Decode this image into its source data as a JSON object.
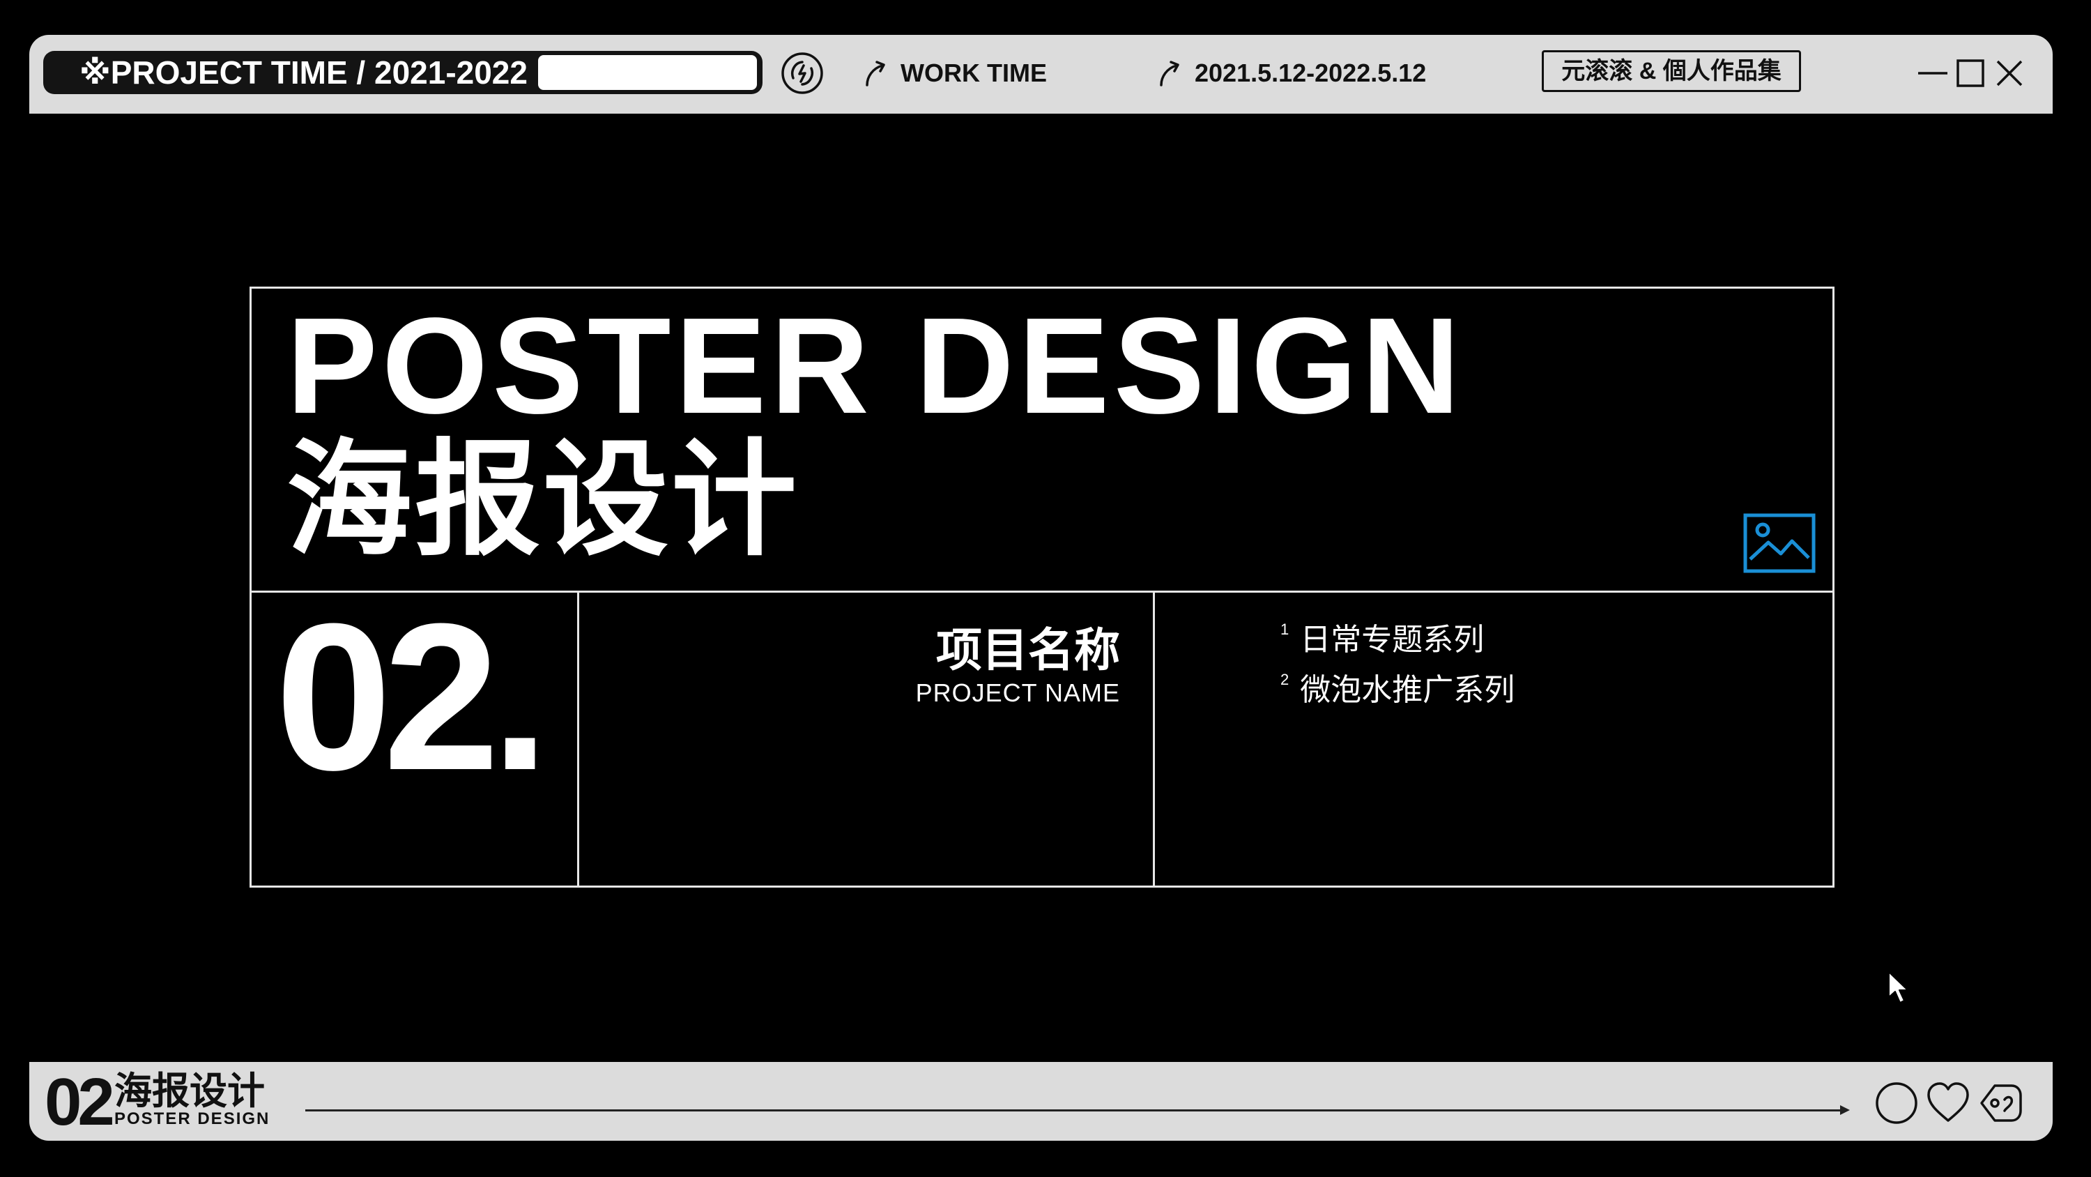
{
  "window": {
    "project_label": "※PROJECT TIME / 2021-2022",
    "project_field_value": "",
    "work_time_label": "WORK TIME",
    "date_range": "2021.5.12-2022.5.12",
    "author_button": "元滚滚 & 個人作品集"
  },
  "icons": {
    "sync": "sync-icon",
    "arrow": "arrow-up-right-icon",
    "minimize": "minimize-icon",
    "maximize": "maximize-icon",
    "close": "close-icon",
    "image": "image-icon",
    "cursor": "cursor-icon",
    "circle": "circle-icon",
    "heart": "heart-icon",
    "tag": "tag-icon"
  },
  "main": {
    "title_en": "POSTER DESIGN",
    "title_cn": "海报设计",
    "section_number": "02.",
    "project_name_cn": "项目名称",
    "project_name_en": "PROJECT NAME",
    "series": [
      {
        "index": "1",
        "label": "日常专题系列"
      },
      {
        "index": "2",
        "label": "微泡水推广系列"
      }
    ]
  },
  "footer": {
    "number": "02",
    "title_cn": "海报设计",
    "title_en": "POSTER DESIGN"
  },
  "colors": {
    "background": "#000000",
    "bar": "#dcdcdc",
    "pill": "#141414",
    "accent_icon": "#1a8fd6",
    "frame_line": "#e6e6e6"
  }
}
